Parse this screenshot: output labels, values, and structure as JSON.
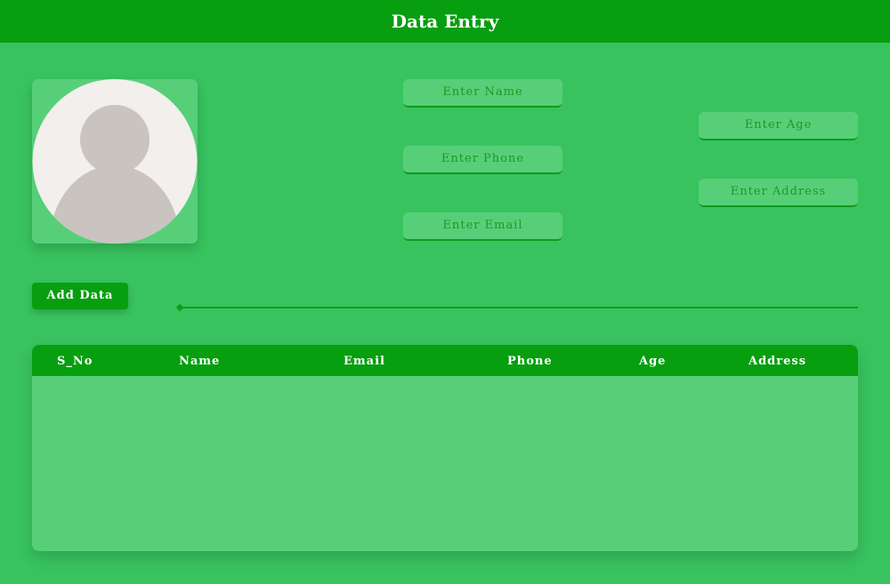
{
  "header": {
    "title": "Data Entry"
  },
  "form": {
    "name_placeholder": "Enter Name",
    "phone_placeholder": "Enter Phone",
    "email_placeholder": "Enter Email",
    "age_placeholder": "Enter Age",
    "address_placeholder": "Enter Address"
  },
  "actions": {
    "add_label": "Add Data"
  },
  "table": {
    "columns": [
      "S_No",
      "Name",
      "Email",
      "Phone",
      "Age",
      "Address"
    ],
    "rows": []
  },
  "icons": {
    "avatar": "user-placeholder-icon"
  },
  "colors": {
    "background": "#38c35f",
    "header": "#079e10",
    "card": "#57cf79",
    "accent_text": "#1a9a25"
  }
}
